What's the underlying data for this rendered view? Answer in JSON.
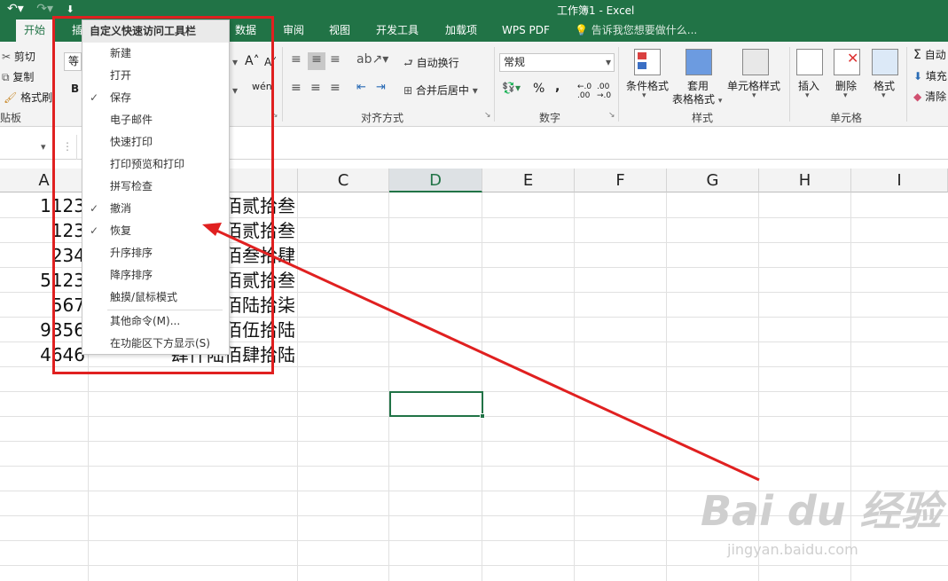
{
  "window": {
    "title": "工作簿1 - Excel",
    "undo_icon": "undo-icon",
    "redo_icon": "redo-icon",
    "customize_icon": "customize-qat-icon"
  },
  "tabs": [
    "开始",
    "插",
    "数据",
    "审阅",
    "视图",
    "开发工具",
    "加载项",
    "WPS PDF"
  ],
  "tell_me": "告诉我您想要做什么...",
  "ribbon": {
    "clipboard": {
      "cut": "剪切",
      "copy": "复制",
      "format_painter": "格式刷",
      "group": "贴板"
    },
    "font": {
      "name_value": "等",
      "bold": "B"
    },
    "alignment": {
      "wrap": "自动换行",
      "merge": "合并后居中",
      "group": "对齐方式"
    },
    "number": {
      "format": "常规",
      "percent": "%",
      "comma": ",",
      "group": "数字"
    },
    "styles": {
      "conditional": "条件格式",
      "table_line1": "套用",
      "table_line2": "表格格式",
      "cell_styles": "单元格样式",
      "group": "样式"
    },
    "cells": {
      "insert": "插入",
      "delete": "删除",
      "format": "格式",
      "group": "单元格"
    },
    "editing": {
      "autosum": "自动",
      "fill": "填充",
      "clear": "清除"
    }
  },
  "sheet": {
    "columns": [
      "A",
      "C",
      "D",
      "E",
      "F",
      "G",
      "H",
      "I"
    ],
    "selected_column": "D",
    "col_a": [
      "1123",
      "123",
      "234",
      "5123",
      "567",
      "9356",
      "4646"
    ],
    "col_b": [
      "佰贰拾叁",
      "佰贰拾叁",
      "佰叁拾肆",
      "佰贰拾叁",
      "佰陆拾柒",
      "佰伍拾陆",
      "肆仟陆佰肆拾陆"
    ]
  },
  "menu": {
    "header": "自定义快速访问工具栏",
    "items": [
      {
        "label": "新建",
        "checked": false
      },
      {
        "label": "打开",
        "checked": false
      },
      {
        "label": "保存",
        "checked": true
      },
      {
        "label": "电子邮件",
        "checked": false
      },
      {
        "label": "快速打印",
        "checked": false
      },
      {
        "label": "打印预览和打印",
        "checked": false
      },
      {
        "label": "拼写检查",
        "checked": false
      },
      {
        "label": "撤消",
        "checked": true
      },
      {
        "label": "恢复",
        "checked": true
      },
      {
        "label": "升序排序",
        "checked": false
      },
      {
        "label": "降序排序",
        "checked": false
      },
      {
        "label": "触摸/鼠标模式",
        "checked": false
      }
    ],
    "more": "其他命令(M)...",
    "below": "在功能区下方显示(S)",
    "check_glyph": "✓"
  },
  "watermark": {
    "brand": "Bai du 经验",
    "url": "jingyan.baidu.com"
  }
}
